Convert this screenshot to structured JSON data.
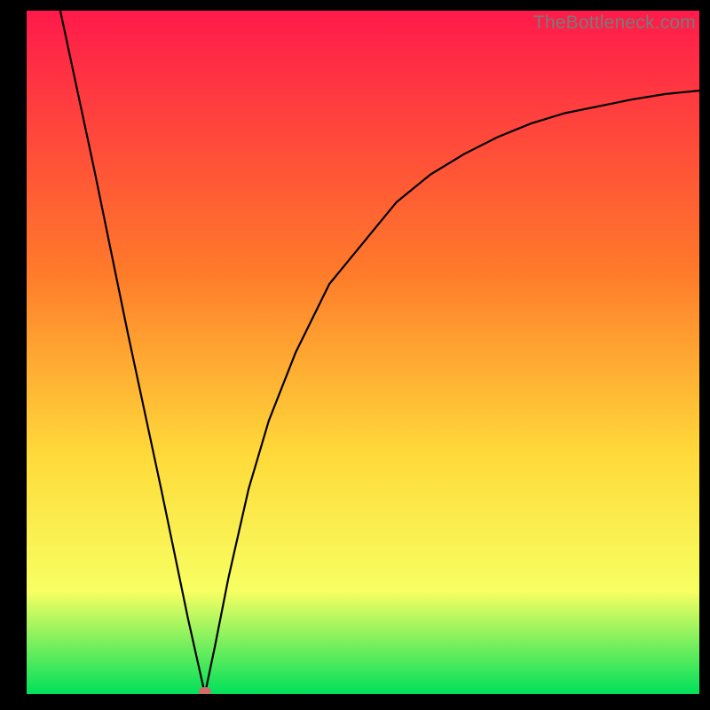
{
  "watermark": "TheBottleneck.com",
  "colors": {
    "background": "#000000",
    "gradient_top": "#ff1a4b",
    "gradient_mid1": "#ff7a2a",
    "gradient_mid2": "#ffda3a",
    "gradient_mid3": "#f7ff62",
    "gradient_bottom": "#00e05a",
    "curve": "#000000",
    "marker": "#d46a6a"
  },
  "chart_data": {
    "type": "line",
    "title": "",
    "xlabel": "",
    "ylabel": "",
    "xlim": [
      0,
      100
    ],
    "ylim": [
      0,
      100
    ],
    "grid": false,
    "legend": null,
    "annotations": [],
    "marker": {
      "x": 26.5,
      "y": 0
    },
    "series": [
      {
        "name": "curve",
        "x": [
          5,
          10,
          15,
          20,
          24,
          26.5,
          28,
          30,
          33,
          36,
          40,
          45,
          50,
          55,
          60,
          65,
          70,
          75,
          80,
          85,
          90,
          95,
          100
        ],
        "y": [
          100,
          77,
          53,
          30,
          11,
          0,
          7,
          17,
          30,
          40,
          50,
          60,
          66,
          72,
          76,
          79,
          81.5,
          83.5,
          85,
          86,
          87,
          87.8,
          88.3
        ]
      }
    ]
  }
}
